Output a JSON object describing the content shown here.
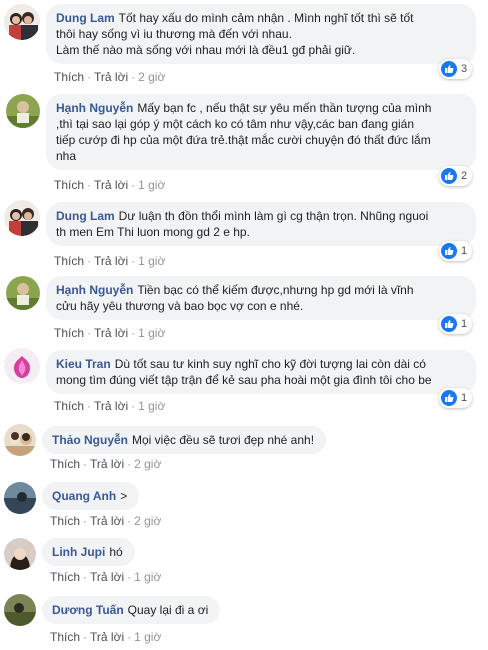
{
  "comments": [
    {
      "name": "Dung Lam",
      "text": "Tốt hay xấu do mình cảm nhận . Mình nghĩ tốt thì sẽ tốt\nthôi hay sống vì iu thương mà đến với nhau.\nLàm thế nào mà sống với nhau mới là đều1 gđ phải giữ.",
      "like": "Thích",
      "reply": "Trả lời",
      "time": "2 giờ",
      "reactions": "3"
    },
    {
      "name": "Hạnh Nguyễn",
      "text": "Mấy bạn fc , nếu thật sự yêu mến thần tượng của mình\n,thì tại sao lại góp ý một cách ko có tâm như vậy,các ban đang gián\ntiếp cướp đi hp của một đứa trẻ.thật mắc cười chuyện đó thất đức lắm\nnha",
      "like": "Thích",
      "reply": "Trả lời",
      "time": "1 giờ",
      "reactions": "2"
    },
    {
      "name": "Dung Lam",
      "text": "Dư luận th đồn thổi mình làm gì cg thận trọn. Nhũng nguoi\nth men Em Thi luon mong gd 2 e hp.",
      "like": "Thích",
      "reply": "Trả lời",
      "time": "1 giờ",
      "reactions": "1"
    },
    {
      "name": "Hạnh Nguyễn",
      "text": "Tiền bạc có thể kiếm được,nhưng hp gd mới là vĩnh\ncửu hãy yêu thương và bao bọc vợ con e nhé.",
      "like": "Thích",
      "reply": "Trả lời",
      "time": "1 giờ",
      "reactions": "1"
    },
    {
      "name": "Kieu Tran",
      "text": "Dù tốt sau tư kinh suy nghĩ cho kỹ đời tượng lai còn dài có\nmong tìm đúng viết tập trận để kẻ sau pha hoài một gia đình tôi cho be",
      "like": "Thích",
      "reply": "Trả lời",
      "time": "1 giờ",
      "reactions": "1"
    },
    {
      "name": "Thảo Nguyễn",
      "text": "Mọi việc đều sẽ tươi đẹp nhé anh!",
      "like": "Thích",
      "reply": "Trả lời",
      "time": "2 giờ"
    },
    {
      "name": "Quang Anh",
      "text": ">",
      "like": "Thích",
      "reply": "Trả lời",
      "time": "2 giờ"
    },
    {
      "name": "Linh Jupi",
      "text": "hó",
      "like": "Thích",
      "reply": "Trả lời",
      "time": "1 giờ"
    },
    {
      "name": "Dương Tuấn",
      "text": "Quay lại đi a ơi",
      "like": "Thích",
      "reply": "Trả lời",
      "time": "1 giờ"
    }
  ],
  "colors": {
    "link": "#385898",
    "bubble": "#f2f3f5",
    "like_blue": "#1877f2",
    "meta": "#90949c"
  },
  "icons": {
    "reaction": "like-thumbs-up-icon"
  }
}
